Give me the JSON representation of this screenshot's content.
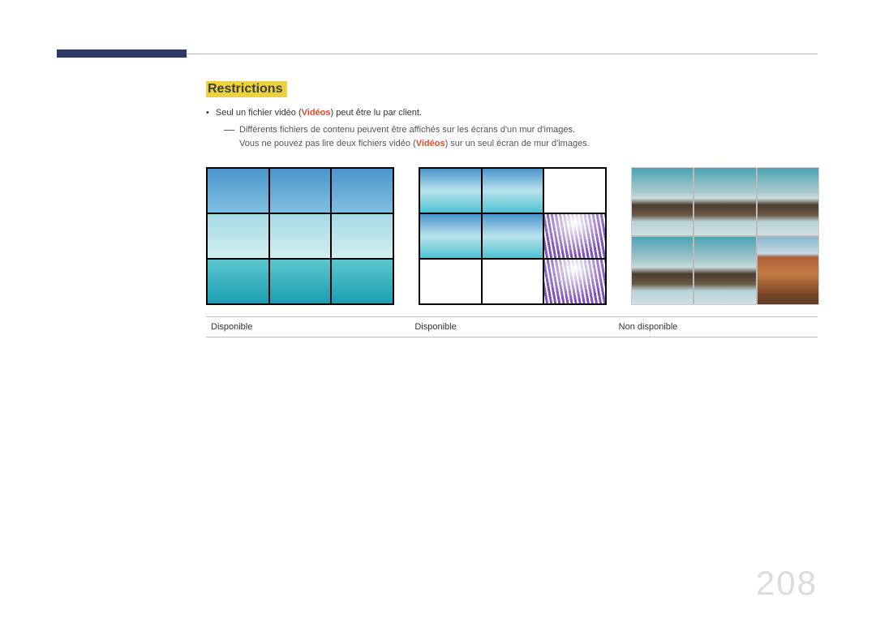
{
  "section": {
    "title": "Restrictions"
  },
  "bullets": {
    "line1_pre": "Seul un fichier vidéo (",
    "line1_strong": "Vidéos",
    "line1_post": ") peut être lu par client."
  },
  "note": {
    "line1": "Différents fichiers de contenu peuvent être affichés sur les écrans d'un mur d'images.",
    "line2_pre": "Vous ne pouvez pas lire deux fichiers vidéo (",
    "line2_strong": "Vidéos",
    "line2_post": ") sur un seul écran de mur d'images."
  },
  "captions": {
    "col1": "Disponible",
    "col2": "Disponible",
    "col3": "Non disponible"
  },
  "page_number": "208"
}
